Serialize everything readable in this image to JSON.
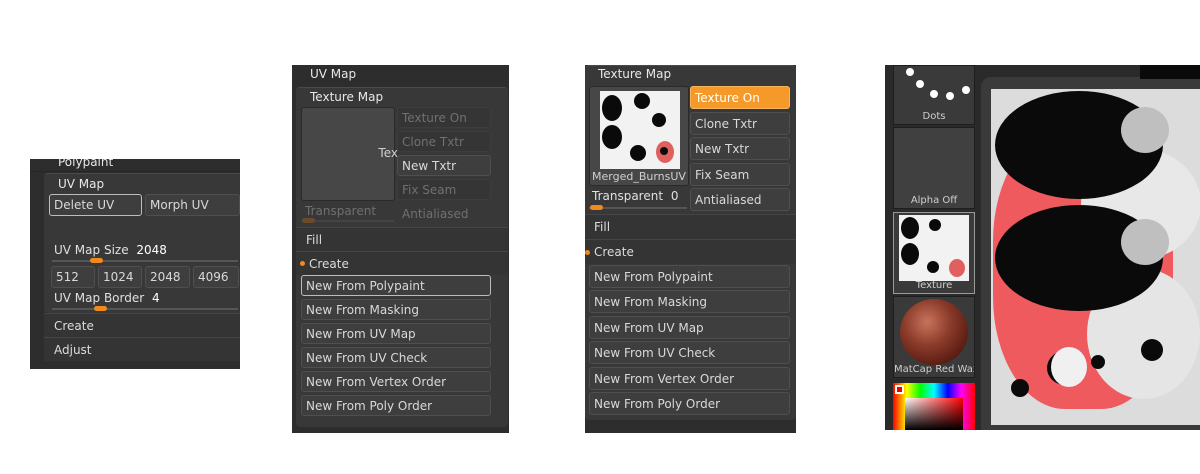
{
  "panel1": {
    "top_label": "Polypaint",
    "section": "UV Map",
    "delete_uv": "Delete UV",
    "morph_uv": "Morph UV",
    "uv_map_size_label": "UV Map Size",
    "uv_map_size_value": "2048",
    "uv_map_size_fraction": 0.24,
    "sizes": [
      "512",
      "1024",
      "2048",
      "4096"
    ],
    "uv_map_border_label": "UV Map Border",
    "uv_map_border_value": "4",
    "uv_map_border_fraction": 0.26,
    "create": "Create",
    "adjust": "Adjust"
  },
  "panel2": {
    "header": "UV Map",
    "section": "Texture Map",
    "thumb_text": "Tex",
    "texture_on": "Texture On",
    "clone_txtr": "Clone Txtr",
    "new_txtr": "New Txtr",
    "fix_seam": "Fix Seam",
    "transparent": "Transparent",
    "antialiased": "Antialiased",
    "fill": "Fill",
    "create": "Create",
    "buttons": [
      "New From Polypaint",
      "New From Masking",
      "New From UV Map",
      "New From UV Check",
      "New From Vertex Order",
      "New From Poly Order"
    ]
  },
  "panel3": {
    "section": "Texture Map",
    "thumb_name": "Merged_BurnsUV",
    "texture_on": "Texture On",
    "clone_txtr": "Clone Txtr",
    "new_txtr": "New Txtr",
    "fix_seam": "Fix Seam",
    "transparent_label": "Transparent",
    "transparent_value": "0",
    "antialiased": "Antialiased",
    "fill": "Fill",
    "create": "Create",
    "buttons": [
      "New From Polypaint",
      "New From Masking",
      "New From UV Map",
      "New From UV Check",
      "New From Vertex Order",
      "New From Poly Order"
    ],
    "accent_color": "#f59a28"
  },
  "panel4": {
    "dots_label": "Dots",
    "alpha_label": "Alpha Off",
    "texture_label": "Texture",
    "matcap_label": "MatCap Red Wax"
  }
}
